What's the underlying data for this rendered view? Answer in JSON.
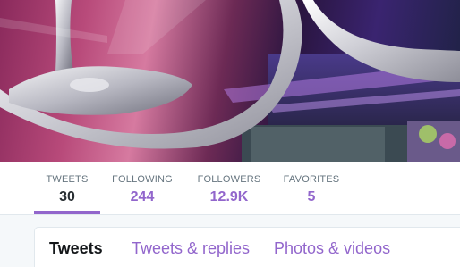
{
  "colors": {
    "accent": "#9266cc",
    "text_dark": "#292f33",
    "label_gray": "#66757f",
    "background": "#f5f8fa"
  },
  "banner": {
    "image_description": "wine-glass-photo-header"
  },
  "stats": [
    {
      "label": "TWEETS",
      "value": "30"
    },
    {
      "label": "FOLLOWING",
      "value": "244"
    },
    {
      "label": "FOLLOWERS",
      "value": "12.9K"
    },
    {
      "label": "FAVORITES",
      "value": "5"
    }
  ],
  "tabs": [
    {
      "label": "Tweets"
    },
    {
      "label": "Tweets & replies"
    },
    {
      "label": "Photos & videos"
    }
  ]
}
